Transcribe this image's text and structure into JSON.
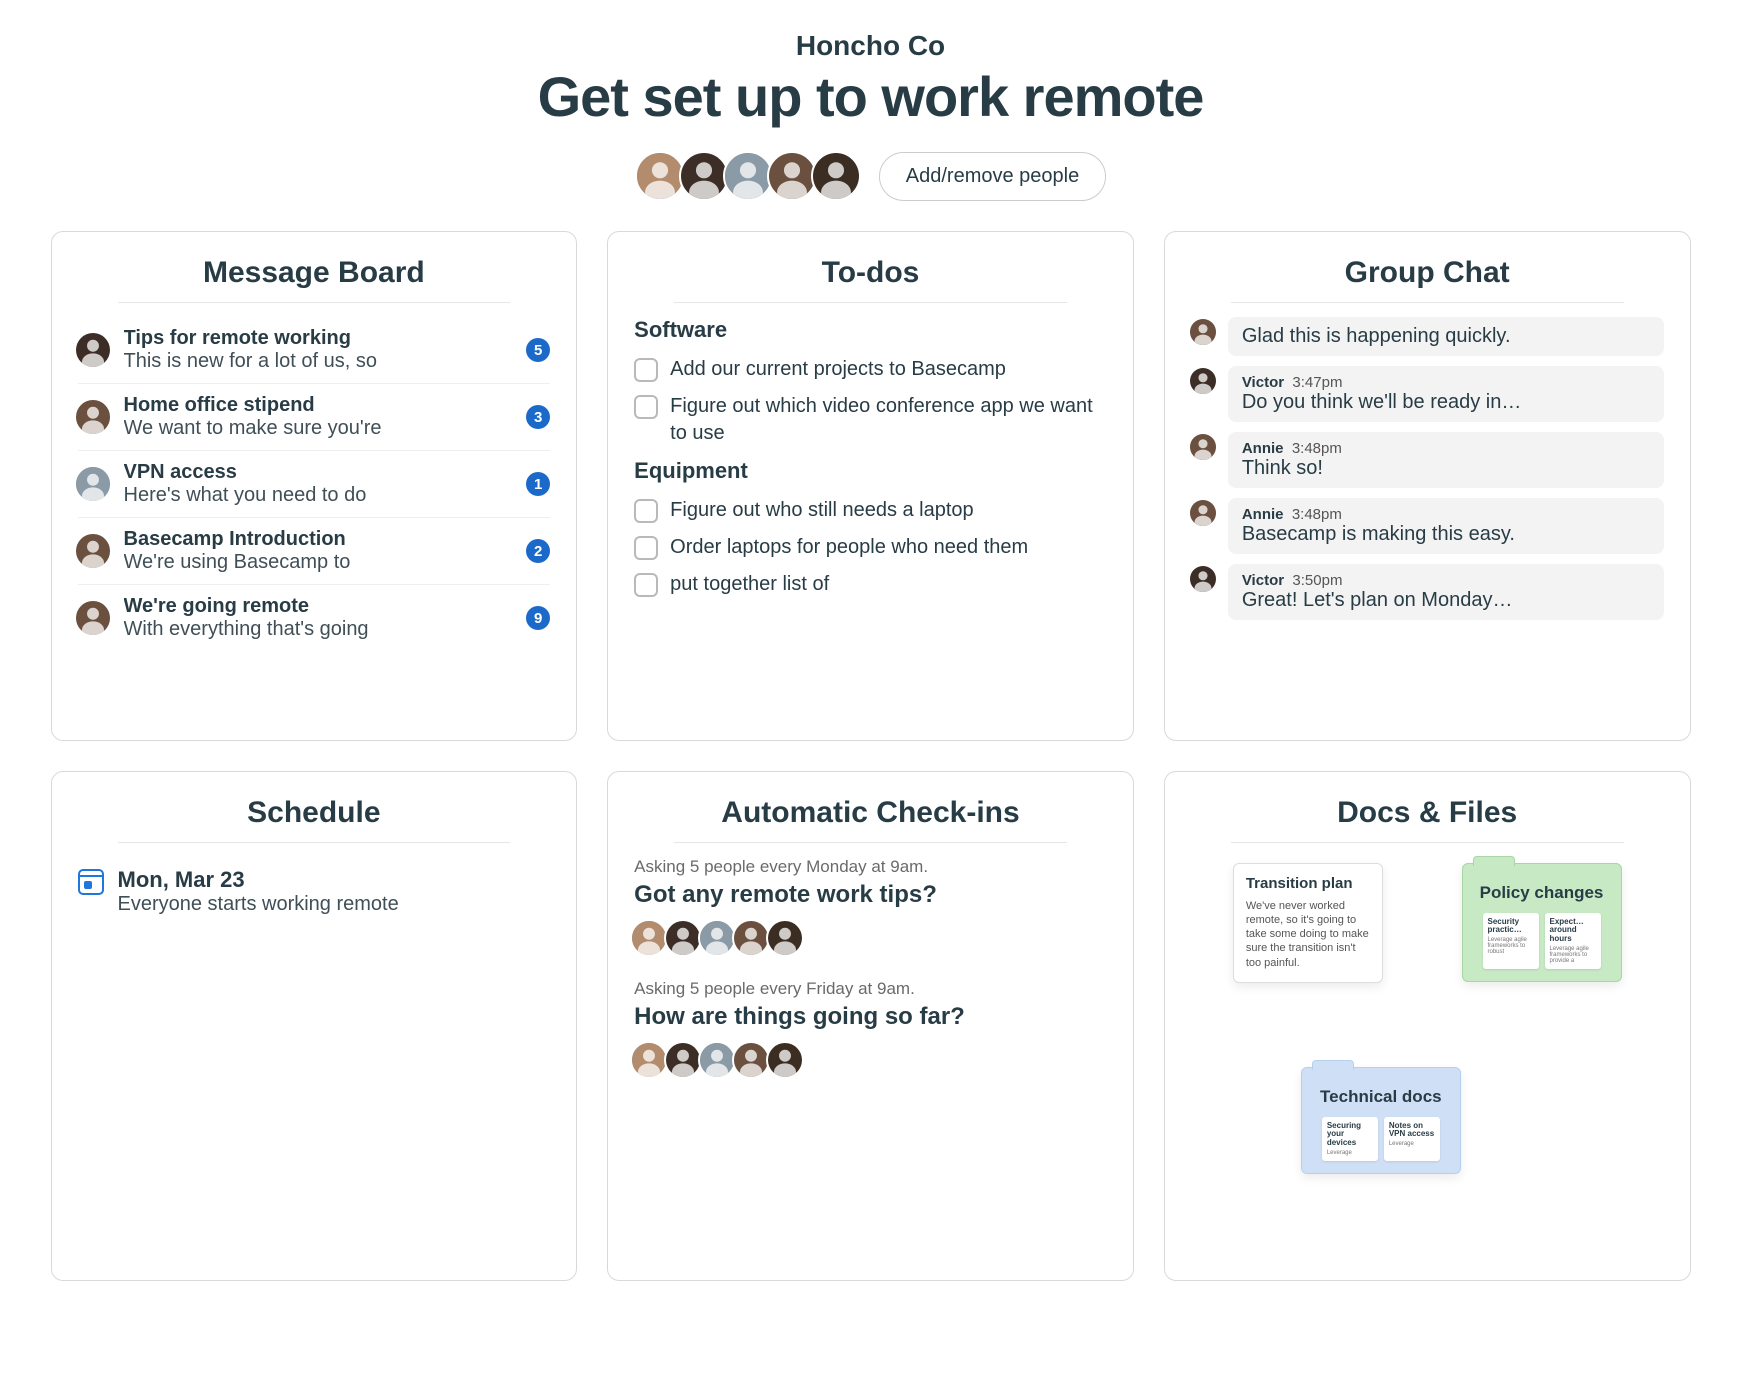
{
  "header": {
    "company": "Honcho Co",
    "title": "Get set up to work remote",
    "add_people_label": "Add/remove people",
    "avatar_colors": [
      "#b38b6d",
      "#3c2e26",
      "#8a9aa6",
      "#6b4f3f",
      "#3b2d22"
    ]
  },
  "cards": {
    "message_board": {
      "title": "Message Board",
      "items": [
        {
          "title": "Tips for remote working",
          "preview": "This is new for a lot of us, so",
          "count": 5,
          "avatar": "#3c2e26"
        },
        {
          "title": "Home office stipend",
          "preview": "We want to make sure you're",
          "count": 3,
          "avatar": "#6b4f3f"
        },
        {
          "title": "VPN access",
          "preview": "Here's what you need to do",
          "count": 1,
          "avatar": "#8a9aa6"
        },
        {
          "title": "Basecamp Introduction",
          "preview": "We're using Basecamp to",
          "count": 2,
          "avatar": "#6b4f3f"
        },
        {
          "title": "We're going remote",
          "preview": "With everything that's going",
          "count": 9,
          "avatar": "#6b4f3f"
        }
      ]
    },
    "todos": {
      "title": "To-dos",
      "groups": [
        {
          "name": "Software",
          "items": [
            "Add our current projects to Basecamp",
            "Figure out which video conference app we want to use"
          ]
        },
        {
          "name": "Equipment",
          "items": [
            "Figure out who still needs a laptop",
            "Order laptops for people who need them",
            "put together list of"
          ]
        }
      ]
    },
    "group_chat": {
      "title": "Group Chat",
      "messages": [
        {
          "name": "",
          "time": "",
          "text": "Glad this is happening quickly.",
          "avatar": "#6b4f3f"
        },
        {
          "name": "Victor",
          "time": "3:47pm",
          "text": "Do you think we'll be ready in…",
          "avatar": "#3c2e26"
        },
        {
          "name": "Annie",
          "time": "3:48pm",
          "text": "Think so!",
          "avatar": "#6b4f3f"
        },
        {
          "name": "Annie",
          "time": "3:48pm",
          "text": "Basecamp is making this easy.",
          "avatar": "#6b4f3f"
        },
        {
          "name": "Victor",
          "time": "3:50pm",
          "text": "Great! Let's plan on Monday…",
          "avatar": "#3c2e26"
        }
      ]
    },
    "schedule": {
      "title": "Schedule",
      "events": [
        {
          "date": "Mon, Mar 23",
          "desc": "Everyone starts working remote"
        }
      ]
    },
    "checkins": {
      "title": "Automatic Check-ins",
      "items": [
        {
          "schedule": "Asking 5 people every Monday at 9am.",
          "question": "Got any remote work tips?"
        },
        {
          "schedule": "Asking 5 people every Friday at 9am.",
          "question": "How are things going so far?"
        }
      ],
      "avatar_colors": [
        "#b38b6d",
        "#3c2e26",
        "#8a9aa6",
        "#6b4f3f",
        "#3b2d22"
      ]
    },
    "docs": {
      "title": "Docs & Files",
      "doc1": {
        "title": "Transition plan",
        "body": "We've never worked remote, so it's going to take some doing to make sure the transition isn't too painful."
      },
      "folder_green": {
        "title": "Policy changes",
        "mini": [
          {
            "t": "Security practic…",
            "b": "Leverage agile frameworks to robust"
          },
          {
            "t": "Expect… around hours",
            "b": "Leverage agile frameworks to provide a"
          }
        ]
      },
      "folder_blue": {
        "title": "Technical docs",
        "mini": [
          {
            "t": "Securing your devices",
            "b": "Leverage"
          },
          {
            "t": "Notes on VPN access",
            "b": "Leverage"
          }
        ]
      }
    }
  }
}
